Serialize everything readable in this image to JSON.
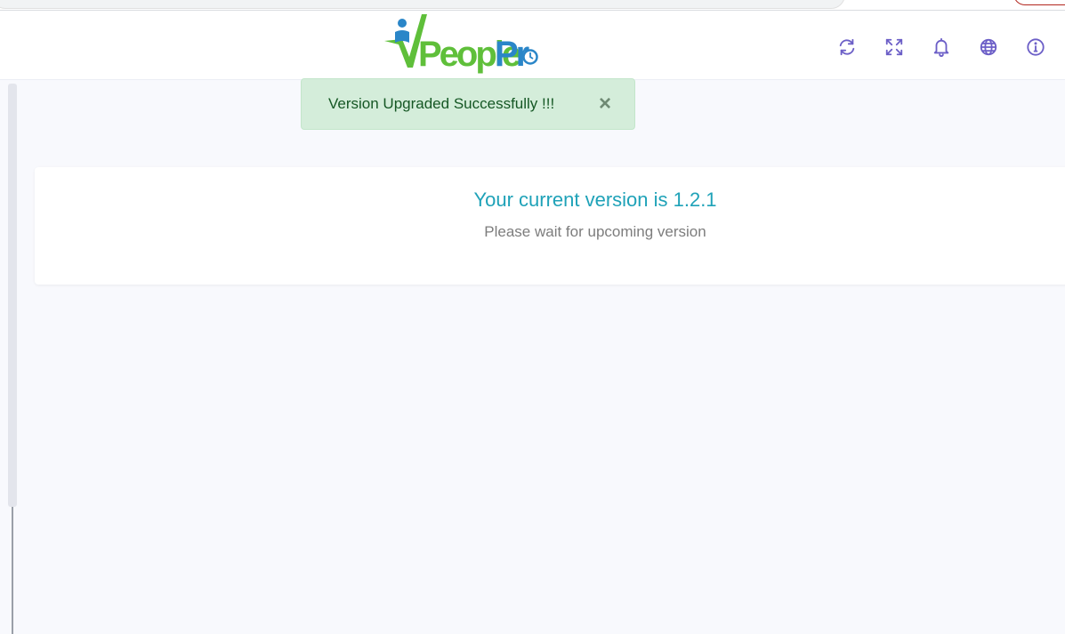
{
  "header": {
    "logo_alt": "PeoplePro",
    "icons": [
      "refresh-icon",
      "fullscreen-icon",
      "bell-icon",
      "globe-icon",
      "info-icon"
    ]
  },
  "alert": {
    "message": "Version Upgraded Successfully !!!",
    "close_label": "×",
    "type": "success"
  },
  "version_card": {
    "title": "Your current version is 1.2.1",
    "subtitle": "Please wait for upcoming version"
  },
  "colors": {
    "icon": "#6c5fc7",
    "title": "#1fa2b8",
    "alert_bg": "#d4edda",
    "alert_text": "#155724",
    "logo_green": "#5fbf3a",
    "logo_blue": "#2a86c8"
  }
}
